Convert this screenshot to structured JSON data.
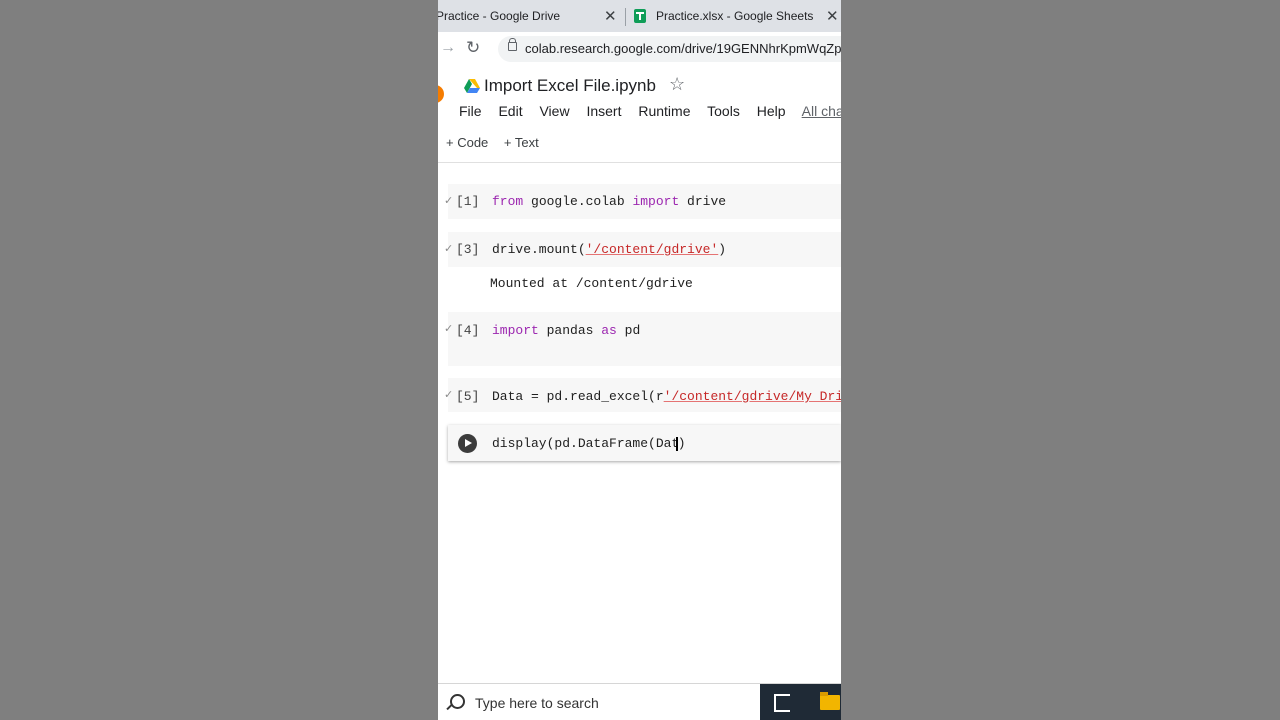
{
  "browser": {
    "tabs": [
      {
        "label": "Practice - Google Drive",
        "close": "✕"
      },
      {
        "label": "Practice.xlsx - Google Sheets",
        "close": "✕"
      }
    ],
    "url": "colab.research.google.com/drive/19GENNhrKpmWqZp"
  },
  "colab": {
    "title": "Import Excel File.ipynb",
    "menu": [
      "File",
      "Edit",
      "View",
      "Insert",
      "Runtime",
      "Tools",
      "Help"
    ],
    "save_status": "All changes saved",
    "toolbar": {
      "code_label": "+ Code",
      "text_label": "+ Text"
    }
  },
  "cells": [
    {
      "prompt": "[1]",
      "code": {
        "kw1": "from",
        "mid": " google.colab ",
        "kw2": "import",
        "end": " drive"
      }
    },
    {
      "prompt": "[3]",
      "code": {
        "pre": "drive.mount(",
        "str": "'/content/gdrive'",
        "post": ")"
      },
      "output": "Mounted at /content/gdrive"
    },
    {
      "prompt": "[4]",
      "code": {
        "kw1": "import",
        "mid": " pandas ",
        "kw2": "as",
        "end": " pd"
      }
    },
    {
      "prompt": "[5]",
      "code": {
        "pre": "Data = pd.read_excel(r",
        "str": "'/content/gdrive/My Drive/P"
      }
    },
    {
      "code": {
        "text": "display(pd.DataFrame(Dat",
        "end": ")"
      }
    }
  ],
  "taskbar": {
    "search_placeholder": "Type here to search"
  }
}
